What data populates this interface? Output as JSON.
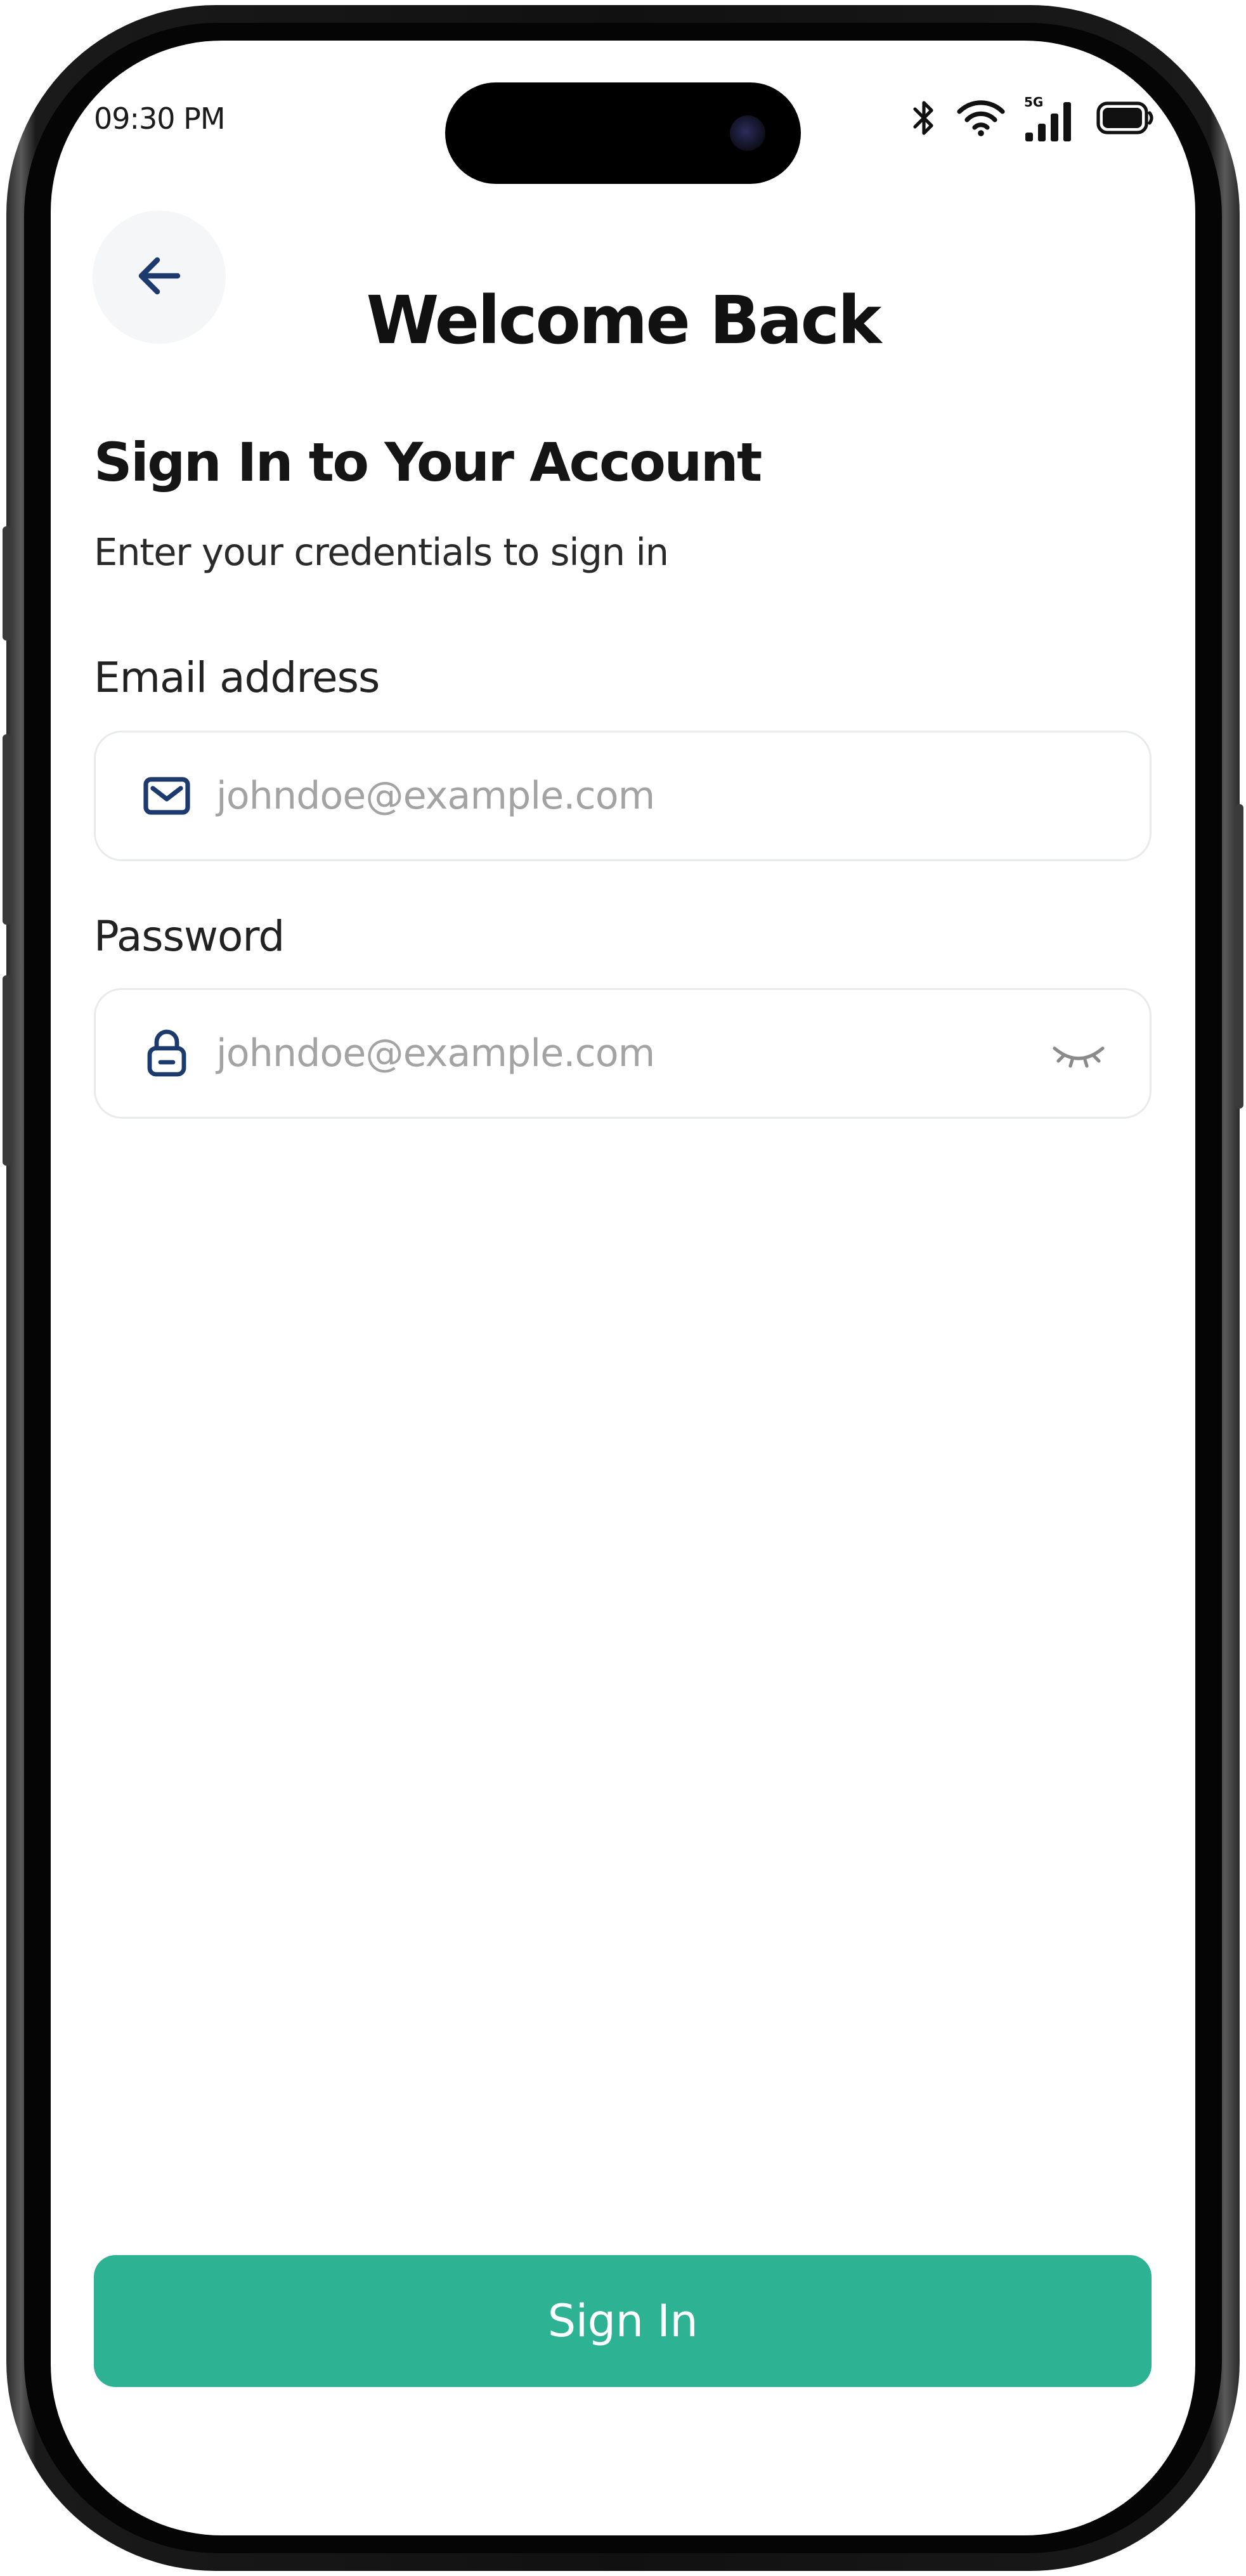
{
  "status_bar": {
    "time": "09:30 PM",
    "network": "5G",
    "icons": [
      "bluetooth-icon",
      "wifi-icon",
      "cellular-signal-icon",
      "battery-icon"
    ]
  },
  "header": {
    "back_icon": "arrow-left-icon",
    "title": "Welcome Back"
  },
  "form": {
    "heading": "Sign In to Your Account",
    "subheading": "Enter your credentials to sign in",
    "email": {
      "label": "Email address",
      "placeholder": "johndoe@example.com",
      "icon": "envelope-icon"
    },
    "password": {
      "label": "Password",
      "placeholder": "johndoe@example.com",
      "icon": "lock-icon",
      "toggle_icon": "eye-closed-icon"
    },
    "submit_label": "Sign In"
  },
  "colors": {
    "accent": "#2db394",
    "icon_navy": "#1d3a6e",
    "placeholder": "#a3a3a3",
    "field_border": "#e9eaec",
    "back_button_bg": "#f5f6f7"
  }
}
